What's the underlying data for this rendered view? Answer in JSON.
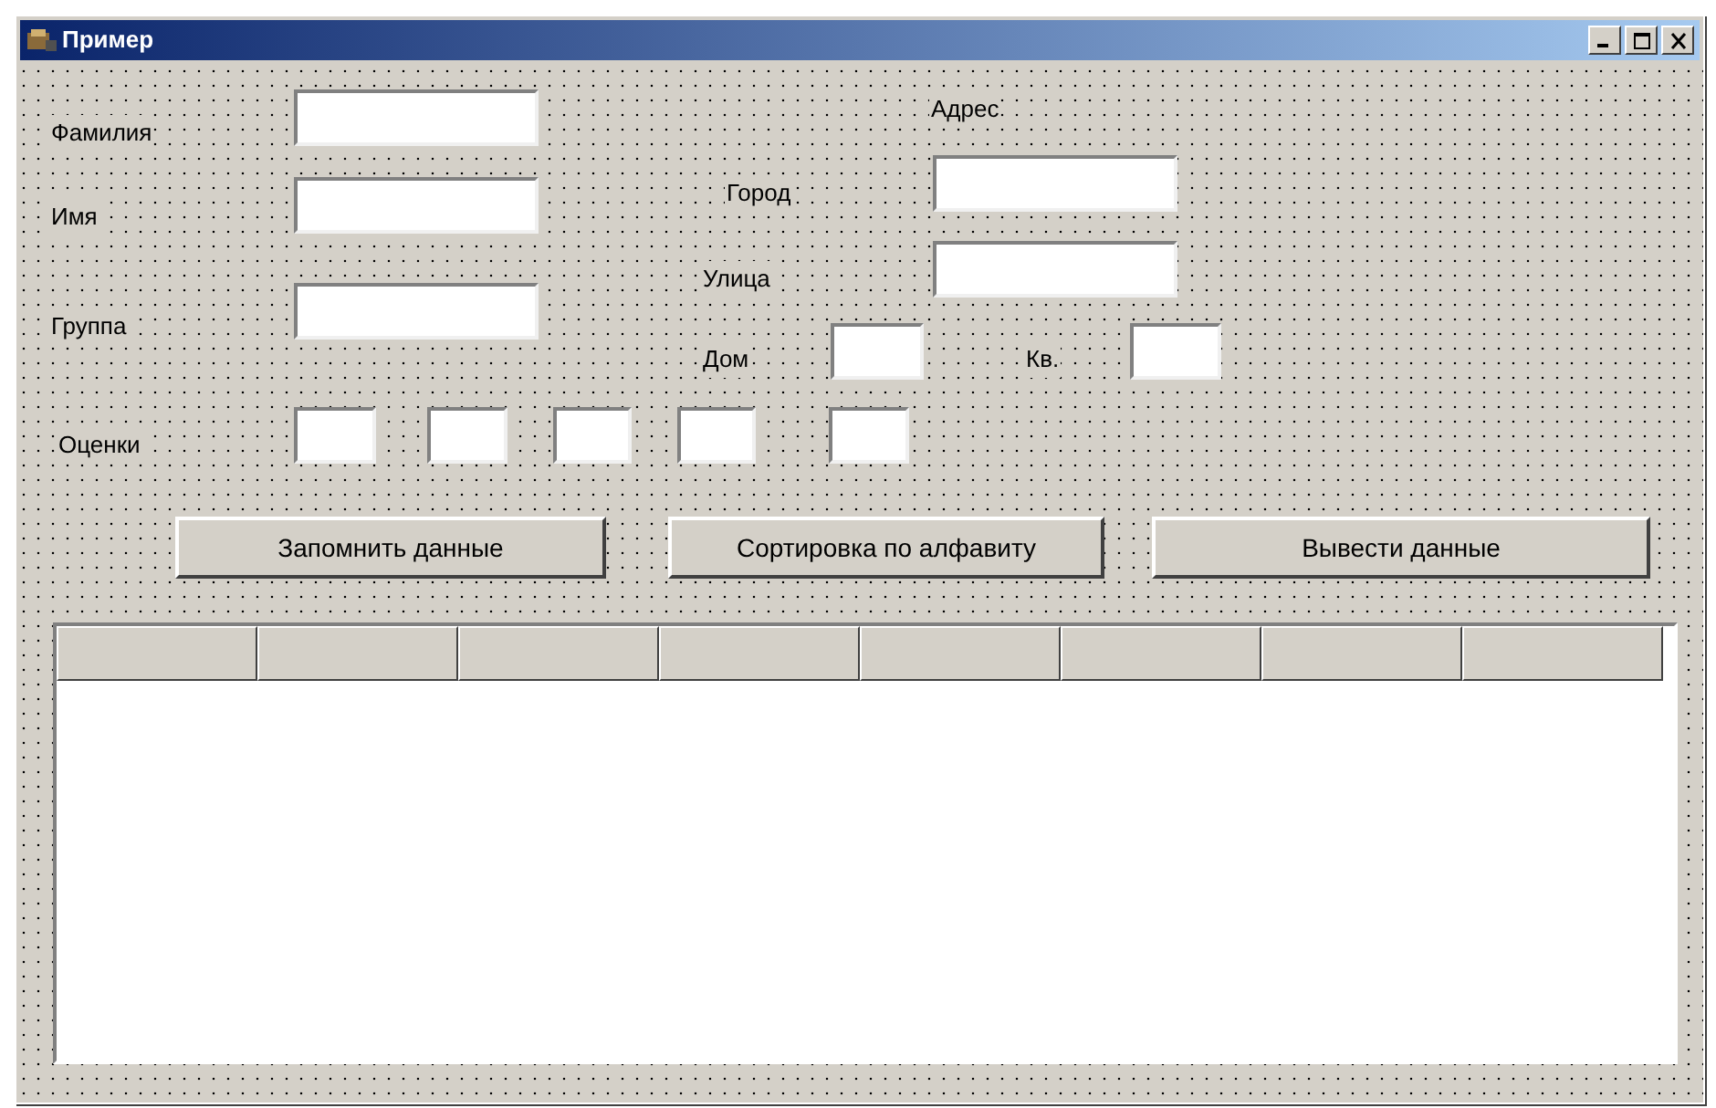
{
  "window": {
    "title": "Пример"
  },
  "labels": [
    "Фамилия",
    "Имя",
    "Группа",
    "Адрес",
    "Город",
    "Улица",
    "Дом",
    "Кв.",
    "Оценки"
  ],
  "buttons": [
    "Запомнить данные",
    "Сортировка по алфавиту",
    "Вывести данные"
  ]
}
